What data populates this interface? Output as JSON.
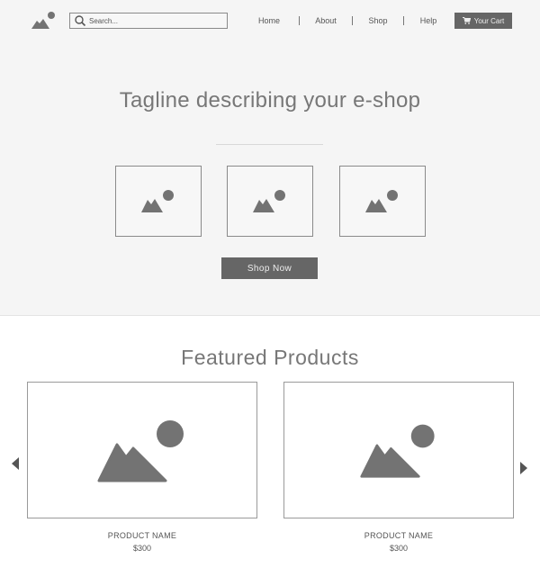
{
  "header": {
    "logo_icon": "image-placeholder-icon",
    "search": {
      "placeholder": "Search...",
      "value": ""
    },
    "nav": [
      {
        "label": "Home"
      },
      {
        "label": "About"
      },
      {
        "label": "Shop"
      },
      {
        "label": "Help"
      }
    ],
    "cart_label": "Your Cart",
    "cart_icon": "cart-icon"
  },
  "hero": {
    "tagline": "Tagline describing your e-shop",
    "images": [
      "image-placeholder-icon",
      "image-placeholder-icon",
      "image-placeholder-icon"
    ],
    "cta_label": "Shop Now"
  },
  "featured": {
    "title": "Featured Products",
    "products": [
      {
        "name": "PRODUCT NAME",
        "price": "$300"
      },
      {
        "name": "PRODUCT NAME",
        "price": "$300"
      }
    ],
    "prev_icon": "arrow-left-icon",
    "next_icon": "arrow-right-icon"
  },
  "colors": {
    "hero_bg": "#f5f5f5",
    "button_bg": "#666666",
    "placeholder_gray": "#737373"
  }
}
